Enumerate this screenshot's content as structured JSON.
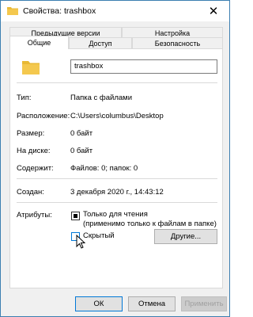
{
  "window": {
    "title": "Свойства: trashbox",
    "close_glyph": "✕"
  },
  "tabs": {
    "row1": [
      "Предыдущие версии",
      "Настройка"
    ],
    "row2": [
      "Общие",
      "Доступ",
      "Безопасность"
    ],
    "active": "Общие"
  },
  "general": {
    "name": "trashbox",
    "rows": [
      {
        "label": "Тип:",
        "value": "Папка с файлами"
      },
      {
        "label": "Расположение:",
        "value": "C:\\Users\\columbus\\Desktop"
      },
      {
        "label": "Размер:",
        "value": "0 байт"
      },
      {
        "label": "На диске:",
        "value": "0 байт"
      },
      {
        "label": "Содержит:",
        "value": "Файлов: 0; папок: 0"
      },
      {
        "label": "Создан:",
        "value": "3 декабря 2020 г., 14:43:12"
      }
    ],
    "attributes_label": "Атрибуты:",
    "readonly_label": "Только для чтения",
    "readonly_note": "(применимо только к файлам в папке)",
    "hidden_label": "Скрытый",
    "other_button": "Другие..."
  },
  "footer": {
    "ok": "ОК",
    "cancel": "Отмена",
    "apply": "Применить"
  },
  "colors": {
    "accent": "#0078d7",
    "folder": "#f4c84e"
  }
}
